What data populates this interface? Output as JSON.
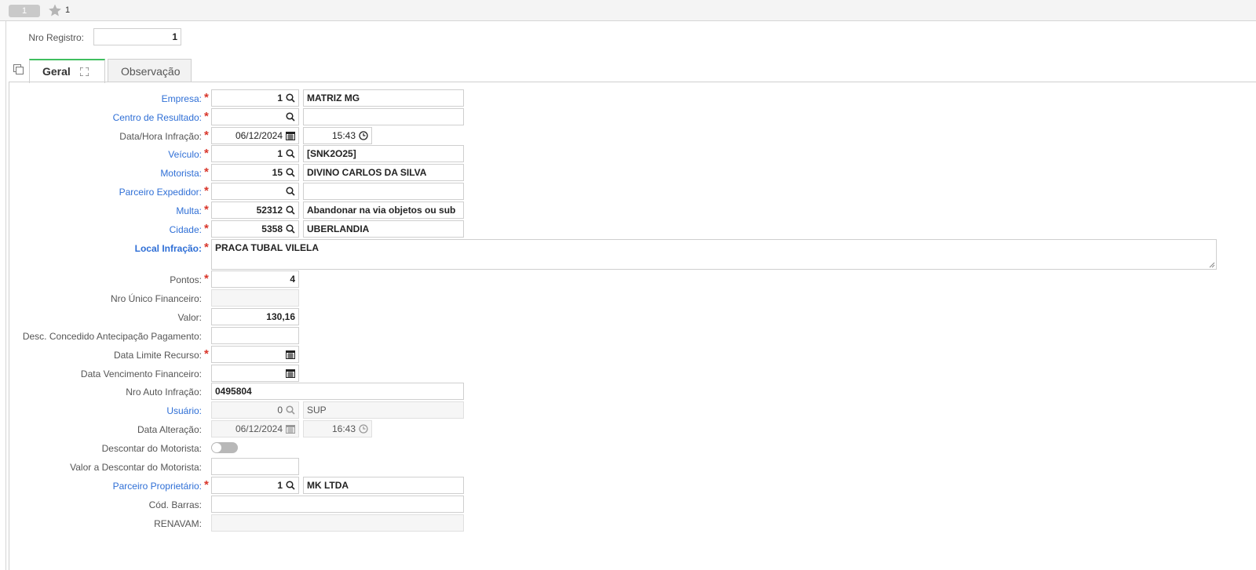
{
  "topbar": {
    "nav_index": "1",
    "favorite_count": "1"
  },
  "header": {
    "registro_label": "Nro Registro:",
    "registro_value": "1"
  },
  "tabs": [
    {
      "label": "Geral"
    },
    {
      "label": "Observação"
    }
  ],
  "form": {
    "empresa": {
      "label": "Empresa:",
      "code": "1",
      "desc": "MATRIZ MG"
    },
    "centro_resultado": {
      "label": "Centro de Resultado:",
      "code": "",
      "desc": ""
    },
    "data_hora_infracao": {
      "label": "Data/Hora Infração:",
      "date": "06/12/2024",
      "time": "15:43"
    },
    "veiculo": {
      "label": "Veículo:",
      "code": "1",
      "desc": "[SNK2O25]"
    },
    "motorista": {
      "label": "Motorista:",
      "code": "15",
      "desc": "DIVINO CARLOS DA SILVA"
    },
    "parceiro_expedidor": {
      "label": "Parceiro Expedidor:",
      "code": "",
      "desc": ""
    },
    "multa": {
      "label": "Multa:",
      "code": "52312",
      "desc": "Abandonar na via objetos ou sub"
    },
    "cidade": {
      "label": "Cidade:",
      "code": "5358",
      "desc": "UBERLANDIA"
    },
    "local_infracao": {
      "label": "Local Infração:",
      "value": "PRACA TUBAL VILELA"
    },
    "pontos": {
      "label": "Pontos:",
      "value": "4"
    },
    "nro_unico_financeiro": {
      "label": "Nro Único Financeiro:",
      "value": ""
    },
    "valor": {
      "label": "Valor:",
      "value": "130,16"
    },
    "desc_antecipacao": {
      "label": "Desc. Concedido Antecipação Pagamento:",
      "value": ""
    },
    "data_limite_recurso": {
      "label": "Data Limite Recurso:",
      "value": ""
    },
    "data_vencimento_financeiro": {
      "label": "Data Vencimento Financeiro:",
      "value": ""
    },
    "nro_auto_infracao": {
      "label": "Nro Auto Infração:",
      "value": "0495804"
    },
    "usuario": {
      "label": "Usuário:",
      "code": "0",
      "desc": "SUP"
    },
    "data_alteracao": {
      "label": "Data Alteração:",
      "date": "06/12/2024",
      "time": "16:43"
    },
    "descontar_motorista": {
      "label": "Descontar do Motorista:",
      "on": false
    },
    "valor_descontar_motorista": {
      "label": "Valor a Descontar do Motorista:",
      "value": ""
    },
    "parceiro_proprietario": {
      "label": "Parceiro Proprietário:",
      "code": "1",
      "desc": "MK LTDA"
    },
    "cod_barras": {
      "label": "Cód. Barras:",
      "value": ""
    },
    "renavam": {
      "label": "RENAVAM:",
      "value": ""
    }
  },
  "colors": {
    "link": "#2f6fd6",
    "required": "#d9362b",
    "active_tab": "#3fbf5f"
  },
  "icons": [
    "star-icon",
    "search-icon",
    "calendar-icon",
    "clock-icon",
    "copy-icon",
    "expand-icon",
    "resize-icon"
  ]
}
